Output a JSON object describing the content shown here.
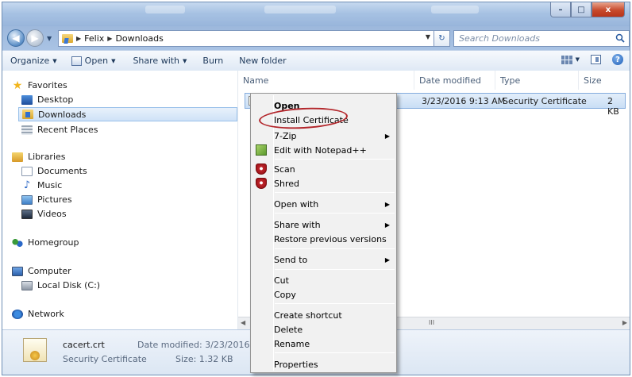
{
  "window": {
    "controls": [
      "–",
      "□",
      "x"
    ]
  },
  "address": {
    "crumbs": [
      "Felix",
      "Downloads"
    ],
    "search_placeholder": "Search Downloads"
  },
  "toolbar": {
    "organize": "Organize",
    "open": "Open",
    "share_with": "Share with",
    "burn": "Burn",
    "new_folder": "New folder"
  },
  "nav": {
    "favorites": "Favorites",
    "desktop": "Desktop",
    "downloads": "Downloads",
    "recent_places": "Recent Places",
    "libraries": "Libraries",
    "documents": "Documents",
    "music": "Music",
    "pictures": "Pictures",
    "videos": "Videos",
    "homegroup": "Homegroup",
    "computer": "Computer",
    "local_disk": "Local Disk (C:)",
    "network": "Network"
  },
  "columns": {
    "name": "Name",
    "date_modified": "Date modified",
    "type": "Type",
    "size": "Size"
  },
  "file": {
    "date_modified": "3/23/2016 9:13 AM",
    "type": "Security Certificate",
    "size": "2 KB"
  },
  "scroll": {
    "grip": "III"
  },
  "details": {
    "filename": "cacert.crt",
    "type": "Security Certificate",
    "date_label": "Date modified: 3/23/2016 9:13 A",
    "size_label": "Size: 1.32 KB"
  },
  "context_menu": {
    "open": "Open",
    "install_certificate": "Install Certificate",
    "seven_zip": "7-Zip",
    "edit_notepad": "Edit with Notepad++",
    "scan": "Scan",
    "shred": "Shred",
    "open_with": "Open with",
    "share_with": "Share with",
    "restore_versions": "Restore previous versions",
    "send_to": "Send to",
    "cut": "Cut",
    "copy": "Copy",
    "create_shortcut": "Create shortcut",
    "delete": "Delete",
    "rename": "Rename",
    "properties": "Properties"
  },
  "colors": {
    "highlight_ellipse": "#b3262b",
    "selection": "#c9def5"
  }
}
